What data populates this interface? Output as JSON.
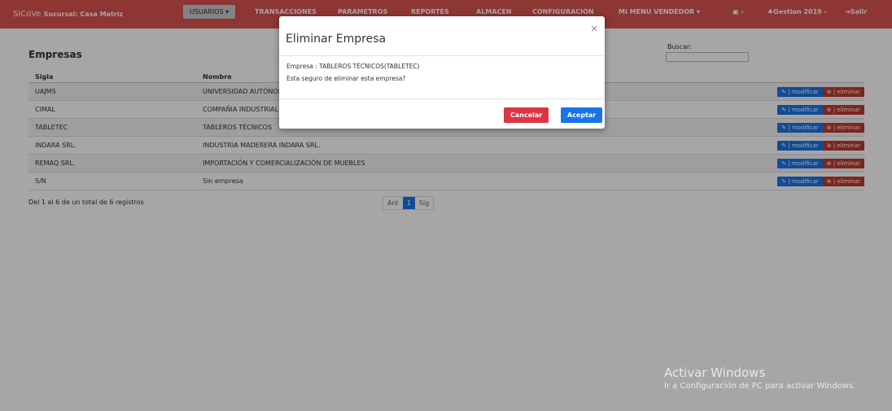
{
  "navbar": {
    "brand": "SiCoVe",
    "branch": "Sucursal: Casa Matriz",
    "menu": [
      {
        "label": "USUARIOS ▾"
      },
      {
        "label": "TRANSACCIONES"
      },
      {
        "label": "PARAMETROS"
      },
      {
        "label": "REPORTES"
      },
      {
        "label": "ALMACEN"
      },
      {
        "label": "CONFIGURACION"
      },
      {
        "label": "MI MENU VENDEDOR ▾"
      }
    ],
    "right": {
      "store_icon": "store-icon",
      "gestion": "Gestion 2019",
      "logout": "Salir"
    }
  },
  "page": {
    "title": "Empresas",
    "search_label": "Buscar:",
    "columns": [
      "Sigla",
      "Nombre"
    ],
    "rows": [
      {
        "sigla": "UAJMS",
        "nombre": "UNIVERSIDAD AUTÓNOMA JUAN MISAEL SARACHO"
      },
      {
        "sigla": "CIMAL",
        "nombre": "COMPAÑIA INDUSTRIAL DE MADERAS"
      },
      {
        "sigla": "TABLETEC",
        "nombre": "TABLEROS TÉCNICOS"
      },
      {
        "sigla": "INDARA SRL.",
        "nombre": "INDUSTRIA MADERERA INDARA SRL."
      },
      {
        "sigla": "REMAQ SRL.",
        "nombre": "IMPORTACIÓN Y COMERCIALIZACIÓN DE MUEBLES"
      },
      {
        "sigla": "S/N",
        "nombre": "Sin empresa"
      }
    ],
    "modify_label": "| modificar",
    "delete_label": "| eliminar",
    "info": "Del 1 al 6 de un total de 6 registros",
    "pager": {
      "prev": "Ant",
      "current": "1",
      "next": "Sig"
    }
  },
  "modal": {
    "title": "Eliminar Empresa",
    "close": "×",
    "line1": "Empresa : TABLEROS TÉCNICOS(TABLETEC)",
    "line2": "Esta seguro de eliminar esta empresa?",
    "cancel": "Cancelar",
    "accept": "Aceptar"
  },
  "watermark": {
    "line1": "Activar Windows",
    "line2": "Ir a Configuración de PC para activar Windows."
  },
  "colors": {
    "navbar": "#d9534f",
    "primary": "#1a73e8",
    "danger": "#dc3545"
  }
}
